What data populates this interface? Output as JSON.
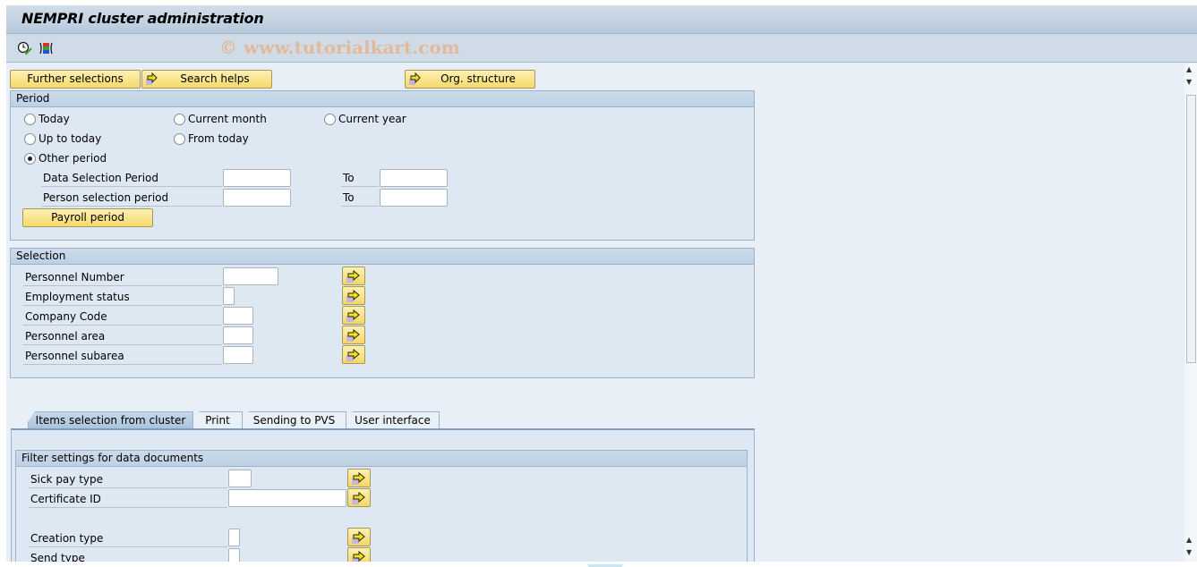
{
  "window": {
    "title": "NEMPRI cluster administration",
    "watermark": "© www.tutorialkart.com"
  },
  "toolbar": {
    "icons": [
      {
        "name": "execute-clock-check-icon",
        "tooltip": ""
      },
      {
        "name": "selection-options-icon",
        "tooltip": ""
      }
    ]
  },
  "buttons": {
    "further_selections": "Further selections",
    "search_helps": "Search helps",
    "org_structure": "Org. structure"
  },
  "period": {
    "title": "Period",
    "radios": [
      {
        "label": "Today",
        "selected": false
      },
      {
        "label": "Current month",
        "selected": false
      },
      {
        "label": "Current year",
        "selected": false
      },
      {
        "label": "Up to today",
        "selected": false
      },
      {
        "label": "From today",
        "selected": false
      },
      {
        "label": "Other period",
        "selected": true
      }
    ],
    "fields": [
      {
        "label": "Data Selection Period",
        "from": "",
        "to_label": "To",
        "to": ""
      },
      {
        "label": "Person selection period",
        "from": "",
        "to_label": "To",
        "to": ""
      }
    ],
    "payroll_button": "Payroll period"
  },
  "selection": {
    "title": "Selection",
    "fields": [
      {
        "label": "Personnel Number",
        "value": ""
      },
      {
        "label": "Employment status",
        "value": ""
      },
      {
        "label": "Company Code",
        "value": ""
      },
      {
        "label": "Personnel area",
        "value": ""
      },
      {
        "label": "Personnel subarea",
        "value": ""
      }
    ]
  },
  "tabs": [
    {
      "label": "Items selection from cluster",
      "active": true
    },
    {
      "label": "Print",
      "active": false
    },
    {
      "label": "Sending to PVS",
      "active": false
    },
    {
      "label": "User interface",
      "active": false
    }
  ],
  "filter": {
    "title": "Filter settings for data documents",
    "fields": [
      {
        "label": "Sick pay type",
        "value": ""
      },
      {
        "label": "Certificate ID",
        "value": ""
      },
      {
        "label": "Creation type",
        "value": ""
      },
      {
        "label": "Send type",
        "value": ""
      }
    ]
  },
  "colors": {
    "button_yellow": "#f6d96a",
    "header_blue": "#b8c9dc",
    "panel_bg": "#dde8f3"
  }
}
